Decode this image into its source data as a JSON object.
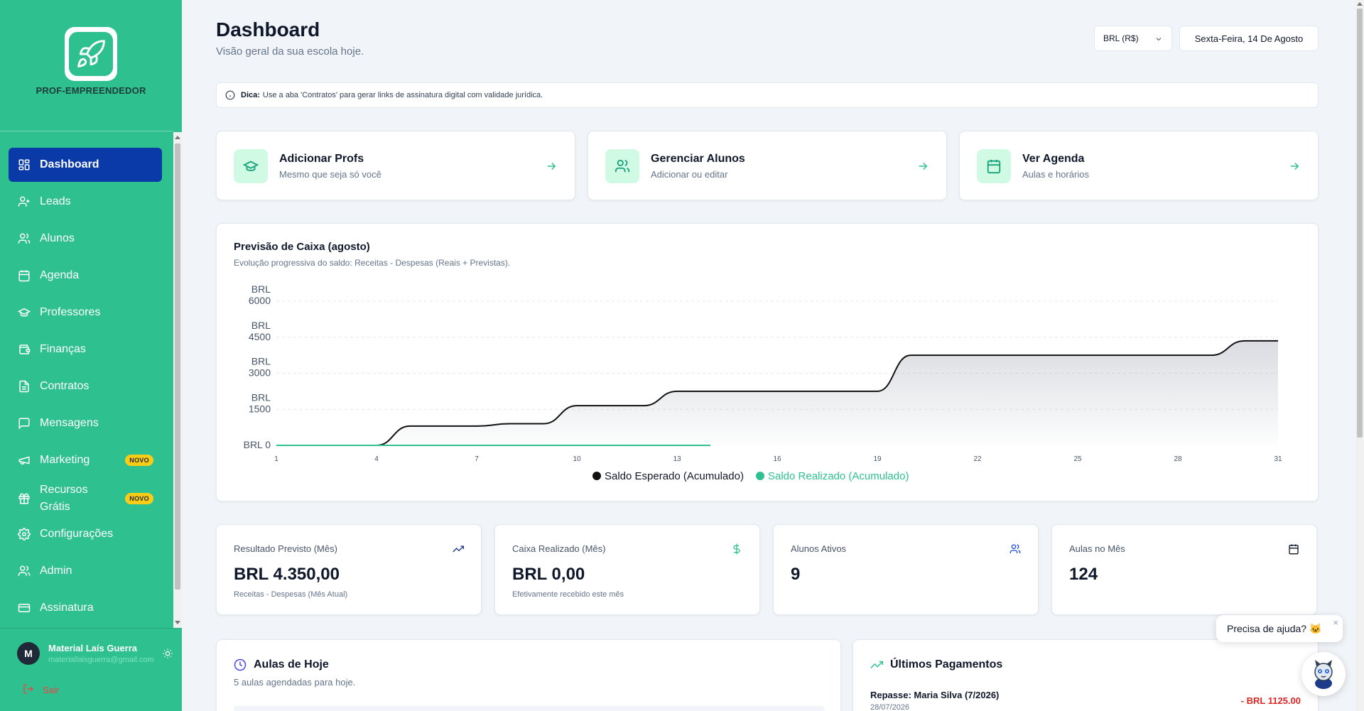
{
  "brand": {
    "name": "PROF-EMPREENDEDOR",
    "primary": "#2ec08e",
    "active": "#0a3aa8"
  },
  "sidebar": {
    "items": [
      {
        "label": "Dashboard",
        "icon": "dashboard-icon"
      },
      {
        "label": "Leads",
        "icon": "user-plus-icon"
      },
      {
        "label": "Alunos",
        "icon": "users-icon"
      },
      {
        "label": "Agenda",
        "icon": "calendar-icon"
      },
      {
        "label": "Professores",
        "icon": "graduation-cap-icon"
      },
      {
        "label": "Finanças",
        "icon": "wallet-icon"
      },
      {
        "label": "Contratos",
        "icon": "file-text-icon"
      },
      {
        "label": "Mensagens",
        "icon": "message-icon"
      },
      {
        "label": "Marketing",
        "icon": "megaphone-icon",
        "badge": "NOVO"
      },
      {
        "label": "Recursos Grátis",
        "icon": "gift-icon",
        "badge": "NOVO"
      },
      {
        "label": "Configurações",
        "icon": "gear-icon"
      },
      {
        "label": "Admin",
        "icon": "users-icon"
      },
      {
        "label": "Assinatura",
        "icon": "card-icon"
      }
    ],
    "user": {
      "initial": "M",
      "name": "Material Laís Guerra",
      "email": "materiallaisguerra@gmail.com"
    },
    "logout_label": "Sair"
  },
  "header": {
    "title": "Dashboard",
    "subtitle": "Visão geral da sua escola hoje.",
    "currency": "BRL (R$)",
    "date": "Sexta-Feira, 14 De Agosto"
  },
  "tip": {
    "prefix": "Dica:",
    "text": "Use a aba 'Contratos' para gerar links de assinatura digital com validade jurídica."
  },
  "quick_actions": [
    {
      "title": "Adicionar Profs",
      "subtitle": "Mesmo que seja só você",
      "icon": "graduation-cap-icon"
    },
    {
      "title": "Gerenciar Alunos",
      "subtitle": "Adicionar ou editar",
      "icon": "users-icon"
    },
    {
      "title": "Ver Agenda",
      "subtitle": "Aulas e horários",
      "icon": "calendar-icon"
    }
  ],
  "chart": {
    "title": "Previsão de Caixa (agosto)",
    "subtitle": "Evolução progressiva do saldo: Receitas - Despesas (Reais + Previstas)."
  },
  "chart_data": {
    "type": "area",
    "title": "Previsão de Caixa (agosto)",
    "ylim": [
      0,
      6000
    ],
    "yticks": [
      {
        "value": 0,
        "label": "BRL 0"
      },
      {
        "value": 1500,
        "label": "BRL 1500"
      },
      {
        "value": 3000,
        "label": "BRL 3000"
      },
      {
        "value": 4500,
        "label": "BRL 4500"
      },
      {
        "value": 6000,
        "label": "BRL 6000"
      }
    ],
    "xticks": [
      1,
      4,
      7,
      10,
      13,
      16,
      19,
      22,
      25,
      28,
      31
    ],
    "legend_position": "bottom",
    "grid": true,
    "series": [
      {
        "name": "Saldo Esperado (Acumulado)",
        "color": "#111111",
        "x": [
          1,
          2,
          3,
          4,
          5,
          6,
          7,
          8,
          9,
          10,
          11,
          12,
          13,
          14,
          15,
          16,
          17,
          18,
          19,
          20,
          21,
          22,
          23,
          24,
          25,
          26,
          27,
          28,
          29,
          30,
          31
        ],
        "y": [
          0,
          0,
          0,
          0,
          800,
          800,
          800,
          900,
          900,
          1650,
          1650,
          1650,
          2250,
          2250,
          2250,
          2250,
          2250,
          2250,
          2250,
          3750,
          3750,
          3750,
          3750,
          3750,
          3750,
          3750,
          3750,
          3750,
          3750,
          4350,
          4350
        ]
      },
      {
        "name": "Saldo Realizado (Acumulado)",
        "color": "#2ec08e",
        "x": [
          1,
          2,
          3,
          4,
          5,
          6,
          7,
          8,
          9,
          10,
          11,
          12,
          13,
          14
        ],
        "y": [
          0,
          0,
          0,
          0,
          0,
          0,
          0,
          0,
          0,
          0,
          0,
          0,
          0,
          0
        ]
      }
    ]
  },
  "stats": [
    {
      "label": "Resultado Previsto (Mês)",
      "value": "BRL 4.350,00",
      "desc": "Receitas - Despesas (Mês Atual)",
      "icon": "trending-up-icon"
    },
    {
      "label": "Caixa Realizado (Mês)",
      "value": "BRL 0,00",
      "desc": "Efetivamente recebido este mês",
      "icon": "dollar-icon"
    },
    {
      "label": "Alunos Ativos",
      "value": "9",
      "desc": "",
      "icon": "users-icon"
    },
    {
      "label": "Aulas no Mês",
      "value": "124",
      "desc": "",
      "icon": "calendar-icon"
    }
  ],
  "today": {
    "title": "Aulas de Hoje",
    "subtitle": "5 aulas agendadas para hoje."
  },
  "payments": {
    "title": "Últimos Pagamentos",
    "items": [
      {
        "name": "Repasse: Maria Silva (7/2026)",
        "date": "28/07/2026",
        "amount": "- BRL 1125.00"
      }
    ]
  },
  "help": {
    "text": "Precisa de ajuda? 🐱",
    "close": "×"
  }
}
